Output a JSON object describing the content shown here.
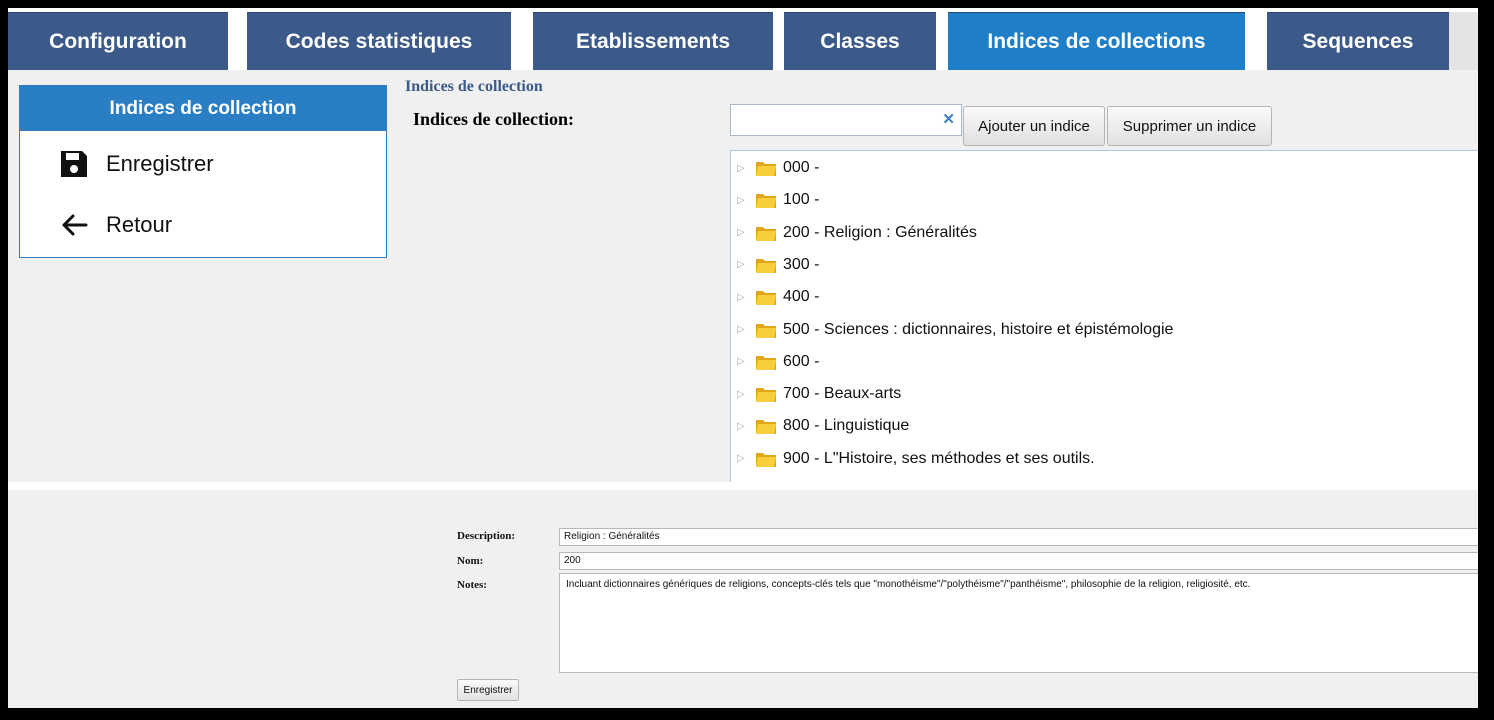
{
  "tabs": [
    {
      "label": "Configuration",
      "active": false
    },
    {
      "label": "Codes statistiques",
      "active": false
    },
    {
      "label": "Etablissements",
      "active": false
    },
    {
      "label": "Classes",
      "active": false
    },
    {
      "label": "Indices de collections",
      "active": true
    },
    {
      "label": "Sequences",
      "active": false
    }
  ],
  "sidebar": {
    "title": "Indices de collection",
    "items": [
      {
        "label": "Enregistrer",
        "icon": "floppy-disk-icon"
      },
      {
        "label": "Retour",
        "icon": "arrow-left-icon"
      }
    ]
  },
  "main": {
    "section_heading": "Indices de collection",
    "field_label": "Indices de collection:",
    "search": {
      "value": "",
      "placeholder": ""
    },
    "clear_symbol": "✕",
    "add_button": "Ajouter un indice",
    "remove_button": "Supprimer un indice"
  },
  "tree": {
    "items": [
      "000 -",
      "100 -",
      "200 - Religion : Généralités",
      "300 -",
      "400 -",
      "500 - Sciences : dictionnaires, histoire et épistémologie",
      "600 -",
      "700 - Beaux-arts",
      "800 - Linguistique",
      "900 - L\"Histoire, ses méthodes et ses outils."
    ]
  },
  "form": {
    "description_label": "Description:",
    "description_value": "Religion : Généralités",
    "name_label": "Nom:",
    "name_value": "200",
    "notes_label": "Notes:",
    "notes_value": "Incluant dictionnaires génériques de religions, concepts-clés tels que \"monothéisme\"/\"polythéisme\"/\"panthéisme\", philosophie de la religion, religiosité, etc.",
    "save_button": "Enregistrer"
  },
  "colors": {
    "tab": "#3b5a8a",
    "tab_active": "#1f7ec8",
    "accent": "#2a7fc4",
    "folder": "#f2c12e"
  }
}
